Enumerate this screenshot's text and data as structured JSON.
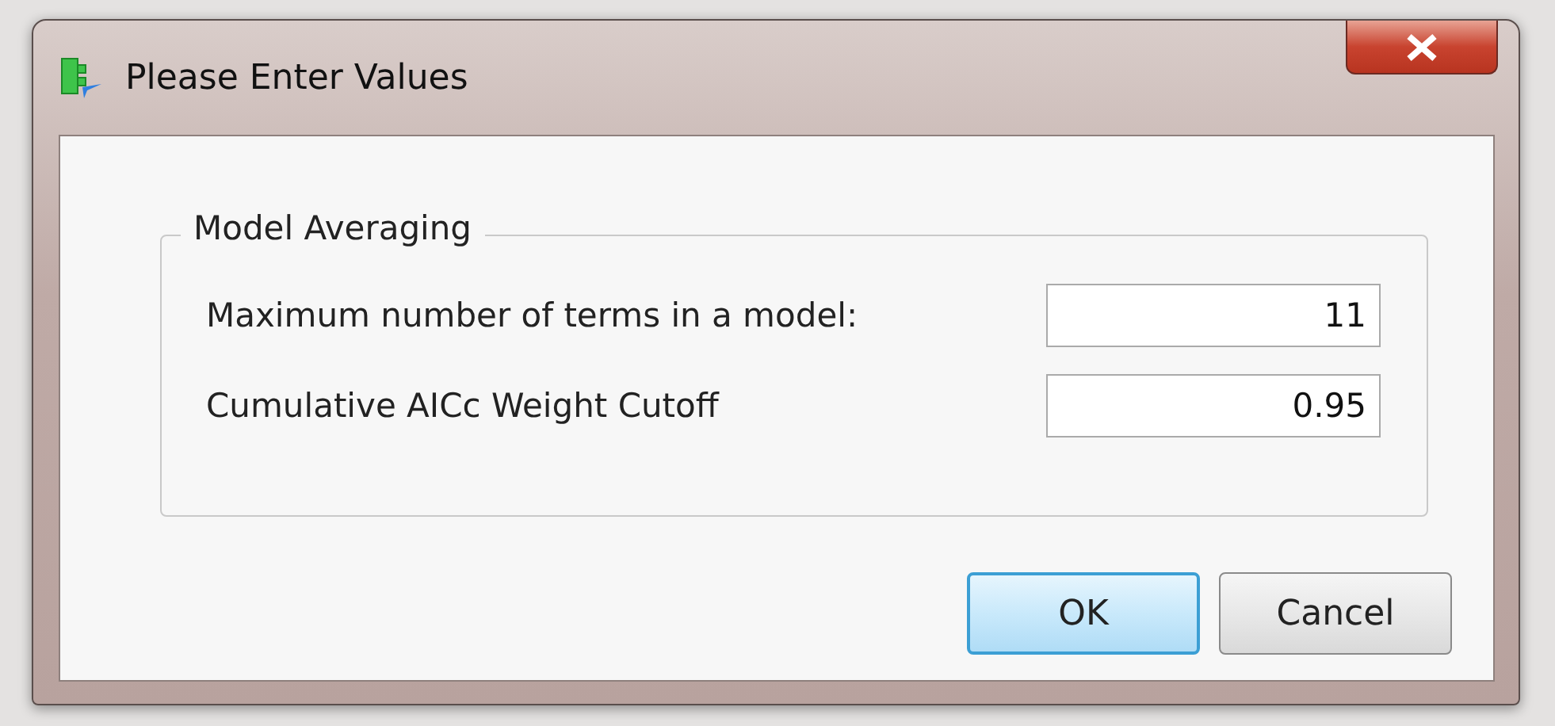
{
  "window": {
    "title": "Please Enter Values"
  },
  "group": {
    "title": "Model Averaging",
    "fields": [
      {
        "label": "Maximum number of terms in a model:",
        "value": "11"
      },
      {
        "label": "Cumulative AICc Weight Cutoff",
        "value": "0.95"
      }
    ]
  },
  "buttons": [
    {
      "label": "OK",
      "default": true
    },
    {
      "label": "Cancel",
      "default": false
    }
  ]
}
